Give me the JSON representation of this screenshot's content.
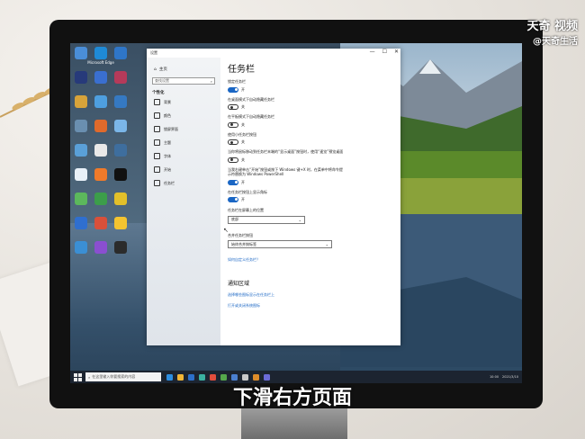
{
  "settings_window": {
    "title": "设置",
    "controls": {
      "minimize": "—",
      "maximize": "☐",
      "close": "✕"
    },
    "nav": {
      "home": "主页",
      "search_placeholder": "查找设置",
      "section": "个性化",
      "items": [
        "背景",
        "颜色",
        "锁屏界面",
        "主题",
        "字体",
        "开始",
        "任务栏"
      ]
    },
    "page_title": "任务栏",
    "settings": [
      {
        "label": "锁定任务栏",
        "state": "开",
        "on": true
      },
      {
        "label": "在桌面模式下自动隐藏任务栏",
        "state": "关",
        "on": false
      },
      {
        "label": "在平板模式下自动隐藏任务栏",
        "state": "关",
        "on": false
      },
      {
        "label": "使用小任务栏按钮",
        "state": "关",
        "on": false
      },
      {
        "label": "当你将鼠标移动到任务栏末端的“显示桌面”按钮时，使用“速览”预览桌面",
        "state": "关",
        "on": false
      },
      {
        "label": "当我右键单击“开始”按钮或按下 Windows 键+X 时，在菜单中将命令提示符替换为 Windows PowerShell",
        "state": "开",
        "on": true
      },
      {
        "label": "在任务栏按钮上显示角标",
        "state": "开",
        "on": true
      }
    ],
    "position": {
      "label": "任务栏在屏幕上的位置",
      "value": "底部"
    },
    "combine": {
      "label": "合并任务栏按钮",
      "value": "始终合并按标签"
    },
    "customize_link": "如何自定义任务栏？",
    "notification_title": "通知区域",
    "notif_link1": "选择哪些图标显示在任务栏上",
    "notif_link2": "打开或关闭系统图标"
  },
  "desktop_icons": [
    {
      "label": "",
      "color": "#4a8ed8"
    },
    {
      "label": "Microsoft Edge",
      "color": "#1f8ad6"
    },
    {
      "label": "",
      "color": "#2f76c8"
    },
    {
      "label": "",
      "color": "#273a7a"
    },
    {
      "label": "",
      "color": "#3a6fd0"
    },
    {
      "label": "",
      "color": "#b53a5a"
    },
    {
      "label": "",
      "color": "#d7a33a"
    },
    {
      "label": "",
      "color": "#4e9fe0"
    },
    {
      "label": "",
      "color": "#3579c2"
    },
    {
      "label": "",
      "color": "#6a8fb0"
    },
    {
      "label": "",
      "color": "#e06a2c"
    },
    {
      "label": "",
      "color": "#7bb6e8"
    },
    {
      "label": "",
      "color": "#5aa0d8"
    },
    {
      "label": "",
      "color": "#e9e9e9"
    },
    {
      "label": "",
      "color": "#3e6e9e"
    },
    {
      "label": "",
      "color": "#e8f0f8"
    },
    {
      "label": "",
      "color": "#f07a2a"
    },
    {
      "label": "",
      "color": "#111111"
    },
    {
      "label": "",
      "color": "#5cb85c"
    },
    {
      "label": "",
      "color": "#3c9e4a"
    },
    {
      "label": "",
      "color": "#e2c02a"
    },
    {
      "label": "",
      "color": "#2f6fcf"
    },
    {
      "label": "",
      "color": "#d8503a"
    },
    {
      "label": "",
      "color": "#f4c430"
    },
    {
      "label": "",
      "color": "#3b8fd4"
    },
    {
      "label": "",
      "color": "#8a4fd0"
    },
    {
      "label": "",
      "color": "#2b2b2b"
    }
  ],
  "taskbar": {
    "search_placeholder": "在这里输入你要搜索的内容",
    "apps": [
      "#2d8ee0",
      "#f1b535",
      "#2c6fc9",
      "#3bb0a0",
      "#e24d3c",
      "#55a84b",
      "#4a7fd0",
      "#c8c8c8",
      "#dd8c2a",
      "#6b6bd8"
    ],
    "time": "10:00",
    "date": "2021/3/10"
  },
  "watermark": {
    "line1": "天奇 视频",
    "line2": "@天奇生活"
  },
  "subtitle": "下滑右方页面"
}
